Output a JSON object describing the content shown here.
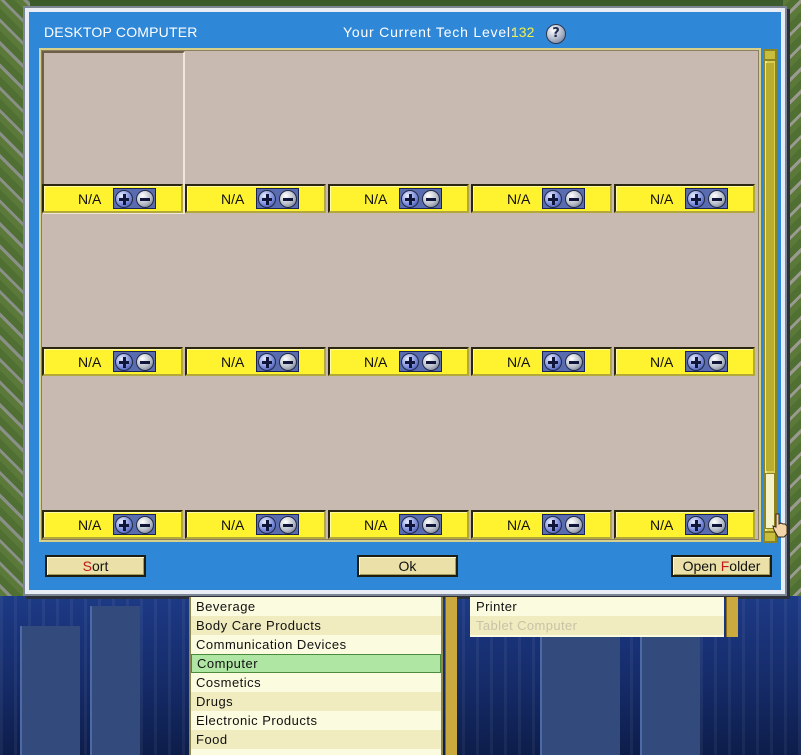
{
  "dialog": {
    "title": "DESKTOP COMPUTER",
    "tech_level_label": "Your Current Tech Level:",
    "tech_level_value": "132"
  },
  "grid": {
    "rows": [
      [
        {
          "label": "N/A"
        },
        {
          "label": "N/A"
        },
        {
          "label": "N/A"
        },
        {
          "label": "N/A"
        },
        {
          "label": "N/A"
        }
      ],
      [
        {
          "label": "N/A"
        },
        {
          "label": "N/A"
        },
        {
          "label": "N/A"
        },
        {
          "label": "N/A"
        },
        {
          "label": "N/A"
        }
      ],
      [
        {
          "label": "N/A"
        },
        {
          "label": "N/A"
        },
        {
          "label": "N/A"
        },
        {
          "label": "N/A"
        },
        {
          "label": "N/A"
        }
      ]
    ]
  },
  "buttons": {
    "sort": {
      "hot": "S",
      "rest": "ort"
    },
    "ok": "Ok",
    "open_folder": {
      "pre": "Open ",
      "hot": "F",
      "rest": "older"
    }
  },
  "categories": {
    "items": [
      "Beverage",
      "Body Care Products",
      "Communication Devices",
      "Computer",
      "Cosmetics",
      "Drugs",
      "Electronic Products",
      "Food"
    ],
    "selected": "Computer"
  },
  "subcategories": {
    "items": [
      "Printer",
      "Tablet Computer"
    ]
  },
  "colors": {
    "dialog_bg": "#2f87d8",
    "cell_bar": "#fff22e",
    "tech_value": "#f3f04a",
    "selected_row": "#b0e6a3"
  }
}
